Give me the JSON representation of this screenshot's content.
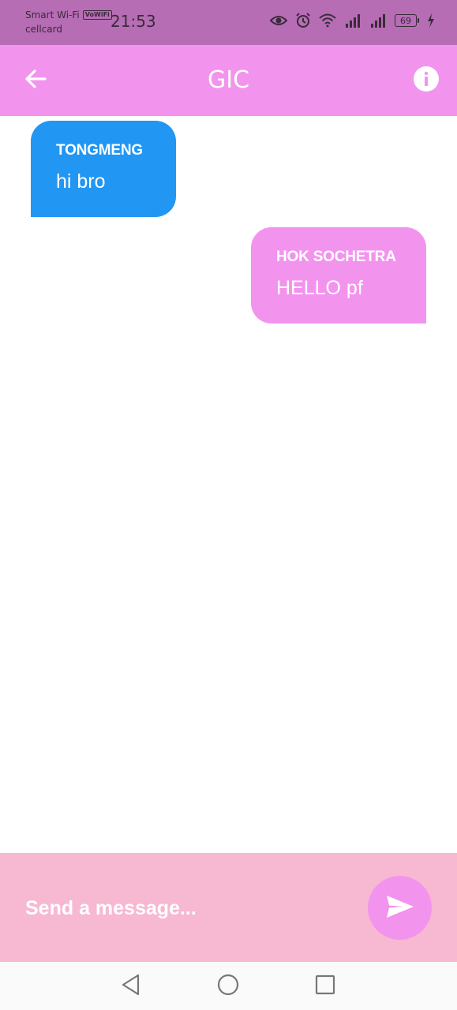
{
  "status_bar": {
    "network_label": "Smart Wi-Fi",
    "vowifi_badge": "VoWiFi",
    "carrier": "cellcard",
    "time": "21:53",
    "battery_level": "69",
    "icons": [
      "eye-icon",
      "alarm-icon",
      "wifi-icon",
      "signal-icon",
      "signal-icon",
      "battery-icon",
      "charging-icon"
    ]
  },
  "app_bar": {
    "title": "GIC",
    "back_icon": "arrow-left-icon",
    "info_icon": "info-icon"
  },
  "messages": [
    {
      "sender": "TONGMENG",
      "text": "hi bro",
      "side": "left",
      "color": "#2196f3"
    },
    {
      "sender": "HOK SOCHETRA",
      "text": "HELLO pf",
      "side": "right",
      "color": "#f294ee"
    }
  ],
  "composer": {
    "placeholder": "Send a message...",
    "value": "",
    "send_icon": "send-icon"
  },
  "nav_bar": {
    "icons": [
      "nav-back-icon",
      "nav-home-icon",
      "nav-recents-icon"
    ]
  },
  "colors": {
    "status_bar": "#b66db4",
    "app_bar": "#f294ee",
    "composer": "#f7b8d1",
    "other_bubble": "#2196f3",
    "my_bubble": "#f294ee"
  }
}
